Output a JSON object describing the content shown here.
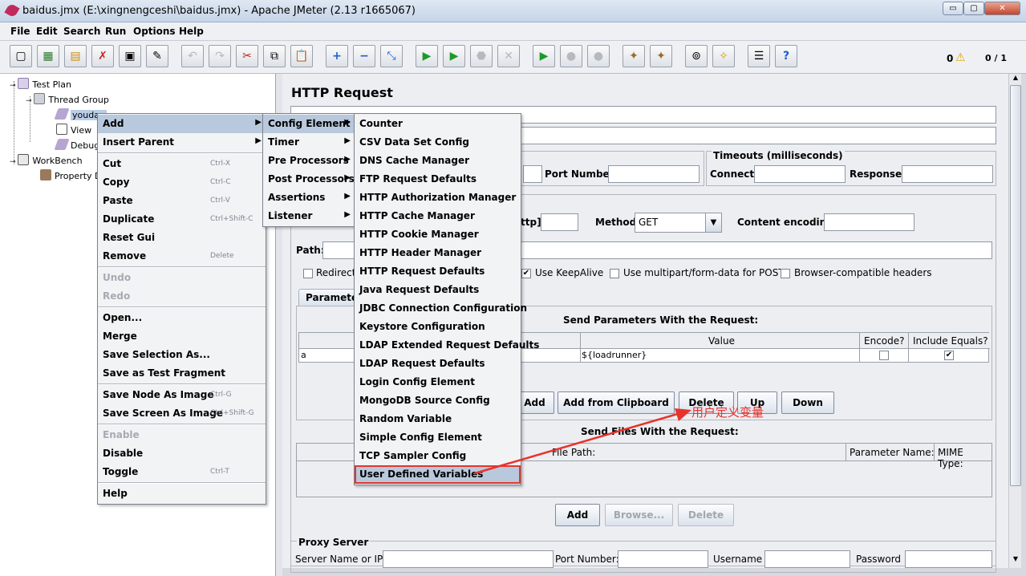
{
  "window": {
    "title": "baidus.jmx (E:\\xingnengceshi\\baidus.jmx) - Apache JMeter (2.13 r1665067)",
    "minimize": "▭",
    "maximize": "▢",
    "close": "✕"
  },
  "menubar": [
    "File",
    "Edit",
    "Search",
    "Run",
    "Options",
    "Help"
  ],
  "toolbar": {
    "error_count": "0",
    "thread_count": "0 / 1"
  },
  "tree": {
    "test_plan": "Test Plan",
    "thread_group": "Thread Group",
    "sampler": "youdao",
    "listener": "View",
    "debug": "Debug",
    "workbench": "WorkBench",
    "property": "Property D"
  },
  "panel": {
    "title": "HTTP Request",
    "timeouts_title": "Timeouts (milliseconds)",
    "connect_label": "Connect:",
    "response_label": "Response:",
    "port_label": "Port Number:",
    "protocol_label": "ttp]:",
    "method_label": "Method:",
    "method_value": "GET",
    "encoding_label": "Content encoding:",
    "path_label": "Path:",
    "redirect_label": "Redirect",
    "keepalive_label": "Use KeepAlive",
    "multipart_label": "Use multipart/form-data for POST",
    "browser_headers_label": "Browser-compatible headers",
    "tab_label": "Paramete",
    "params_title": "Send Parameters With the Request:",
    "col_value": "Value",
    "col_encode": "Encode?",
    "col_equals": "Include Equals?",
    "row_name": "a",
    "row_value": "${loadrunner}",
    "btn_add": "Add",
    "btn_clipboard": "Add from Clipboard",
    "btn_delete": "Delete",
    "btn_up": "Up",
    "btn_down": "Down",
    "files_title": "Send Files With the Request:",
    "col_file_path": "File Path:",
    "col_param_name": "Parameter Name:",
    "col_mime": "MIME Type:",
    "btn_add2": "Add",
    "btn_browse": "Browse...",
    "btn_delete2": "Delete",
    "proxy_title": "Proxy Server",
    "server_label": "Server Name or IP:",
    "proxy_port_label": "Port Number:",
    "username_label": "Username",
    "password_label": "Password"
  },
  "context_menu": {
    "items": [
      {
        "label": "Add",
        "submenu": true
      },
      {
        "label": "Insert Parent",
        "submenu": true
      },
      {
        "label": "Cut",
        "shortcut": "Ctrl-X"
      },
      {
        "label": "Copy",
        "shortcut": "Ctrl-C"
      },
      {
        "label": "Paste",
        "shortcut": "Ctrl-V"
      },
      {
        "label": "Duplicate",
        "shortcut": "Ctrl+Shift-C"
      },
      {
        "label": "Reset Gui"
      },
      {
        "label": "Remove",
        "shortcut": "Delete"
      },
      {
        "label": "Undo"
      },
      {
        "label": "Redo"
      },
      {
        "label": "Open..."
      },
      {
        "label": "Merge"
      },
      {
        "label": "Save Selection As..."
      },
      {
        "label": "Save as Test Fragment"
      },
      {
        "label": "Save Node As Image",
        "shortcut": "Ctrl-G"
      },
      {
        "label": "Save Screen As Image",
        "shortcut": "Ctrl+Shift-G"
      },
      {
        "label": "Enable"
      },
      {
        "label": "Disable"
      },
      {
        "label": "Toggle",
        "shortcut": "Ctrl-T"
      },
      {
        "label": "Help"
      }
    ]
  },
  "add_menu": [
    "Config Element",
    "Timer",
    "Pre Processors",
    "Post Processors",
    "Assertions",
    "Listener"
  ],
  "config_menu": [
    "Counter",
    "CSV Data Set Config",
    "DNS Cache Manager",
    "FTP Request Defaults",
    "HTTP Authorization Manager",
    "HTTP Cache Manager",
    "HTTP Cookie Manager",
    "HTTP Header Manager",
    "HTTP Request Defaults",
    "Java Request Defaults",
    "JDBC Connection Configuration",
    "Keystore Configuration",
    "LDAP Extended Request Defaults",
    "LDAP Request Defaults",
    "Login Config Element",
    "MongoDB Source Config",
    "Random Variable",
    "Simple Config Element",
    "TCP Sampler Config",
    "User Defined Variables"
  ],
  "annotation": {
    "text": "用户定义变量",
    "color": "#e8332b"
  }
}
